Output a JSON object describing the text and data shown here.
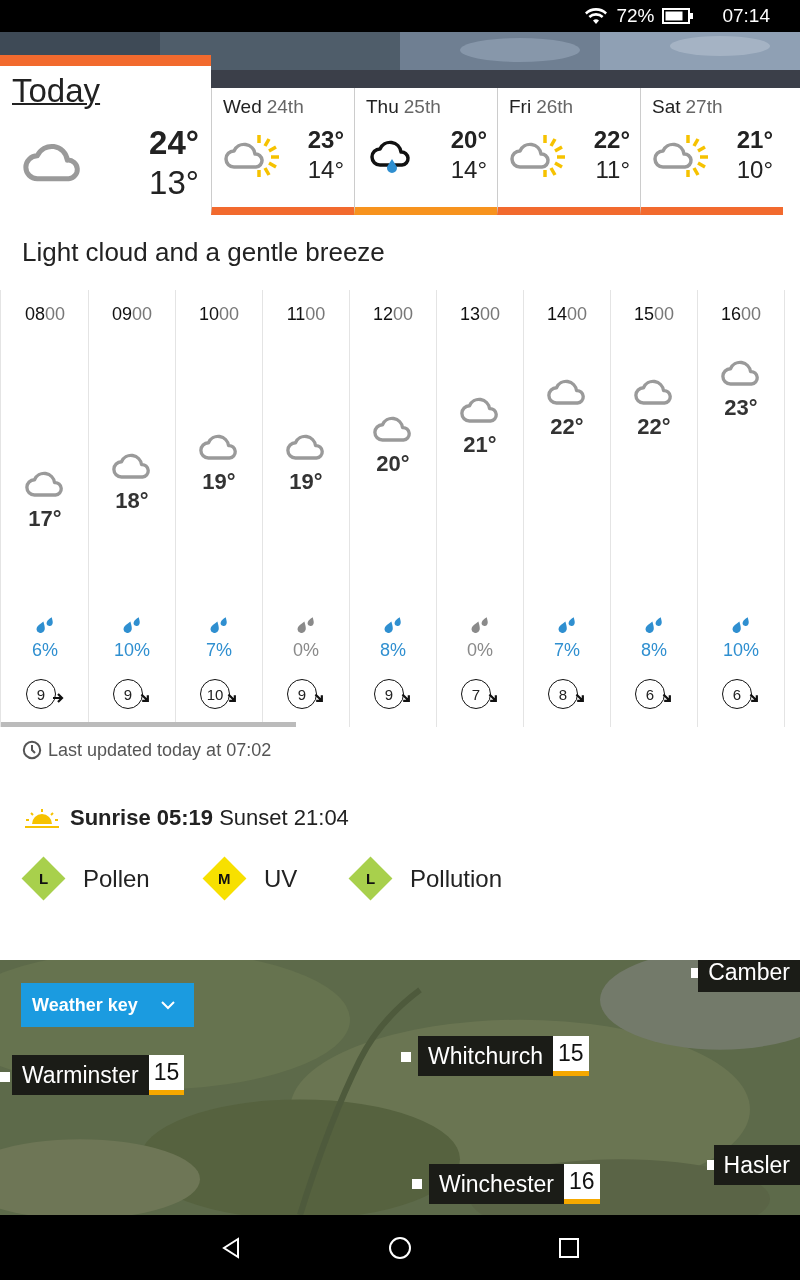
{
  "status_bar": {
    "battery": "72%",
    "time": "07:14"
  },
  "days": [
    {
      "day": "Today",
      "selected": true,
      "kind": "cloud",
      "high": "24°",
      "low": "13°",
      "color": "#f26a2e"
    },
    {
      "day": "Wed",
      "date": "24th",
      "selected": false,
      "kind": "sunny-intervals",
      "high": "23°",
      "low": "14°",
      "color": "#f26a2e"
    },
    {
      "day": "Thu",
      "date": "25th",
      "selected": false,
      "kind": "showers",
      "high": "20°",
      "low": "14°",
      "color": "#f7931e"
    },
    {
      "day": "Fri",
      "date": "26th",
      "selected": false,
      "kind": "sunny-intervals",
      "high": "22°",
      "low": "11°",
      "color": "#f26a2e"
    },
    {
      "day": "Sat",
      "date": "27th",
      "selected": false,
      "kind": "sunny-intervals",
      "high": "21°",
      "low": "10°",
      "color": "#f26a2e"
    }
  ],
  "summary": "Light cloud and a gentle breeze",
  "hours": [
    {
      "time": "**08**00",
      "temp": "17°",
      "rain": "6%",
      "color": "#2f8fd0",
      "kind": "east",
      "wind": "9"
    },
    {
      "time": "**09**00",
      "temp": "18°",
      "rain": "10%",
      "color": "#2f8fd0",
      "kind": "southeast",
      "wind": "9"
    },
    {
      "time": "**10**00",
      "temp": "19°",
      "rain": "7%",
      "color": "#2f8fd0",
      "kind": "southeast",
      "wind": "10"
    },
    {
      "time": "**11**00",
      "temp": "19°",
      "rain": "0%",
      "color": "#8a8a8a",
      "kind": "southeast",
      "wind": "9"
    },
    {
      "time": "**12**00",
      "temp": "20°",
      "rain": "8%",
      "color": "#2f8fd0",
      "kind": "southeast",
      "wind": "9"
    },
    {
      "time": "**13**00",
      "temp": "21°",
      "rain": "0%",
      "color": "#8a8a8a",
      "kind": "southeast",
      "wind": "7"
    },
    {
      "time": "**14**00",
      "temp": "22°",
      "rain": "7%",
      "color": "#2f8fd0",
      "kind": "southeast",
      "wind": "8"
    },
    {
      "time": "**15**00",
      "temp": "22°",
      "rain": "8%",
      "color": "#2f8fd0",
      "kind": "southeast",
      "wind": "6"
    },
    {
      "time": "**16**00",
      "temp": "23°",
      "rain": "10%",
      "color": "#2f8fd0",
      "kind": "southeast",
      "wind": "6"
    }
  ],
  "last_updated": "Last updated today at 07:02",
  "sun": "**Sunrise 05:19** Sunset 21:04",
  "indices": [
    {
      "level": "L",
      "label": "Pollen",
      "color": "#a8d04c"
    },
    {
      "level": "M",
      "label": "UV",
      "color": "#f7e000"
    },
    {
      "level": "L",
      "label": "Pollution",
      "color": "#a8d04c"
    }
  ],
  "map": {
    "weather_key": "Weather key",
    "places": [
      {
        "name": "Warminster",
        "temp": "15"
      },
      {
        "name": "Whitchurch",
        "temp": "15"
      },
      {
        "name": "Winchester",
        "temp": "16"
      },
      {
        "name": "Camber"
      },
      {
        "name": "Hasler"
      }
    ]
  }
}
